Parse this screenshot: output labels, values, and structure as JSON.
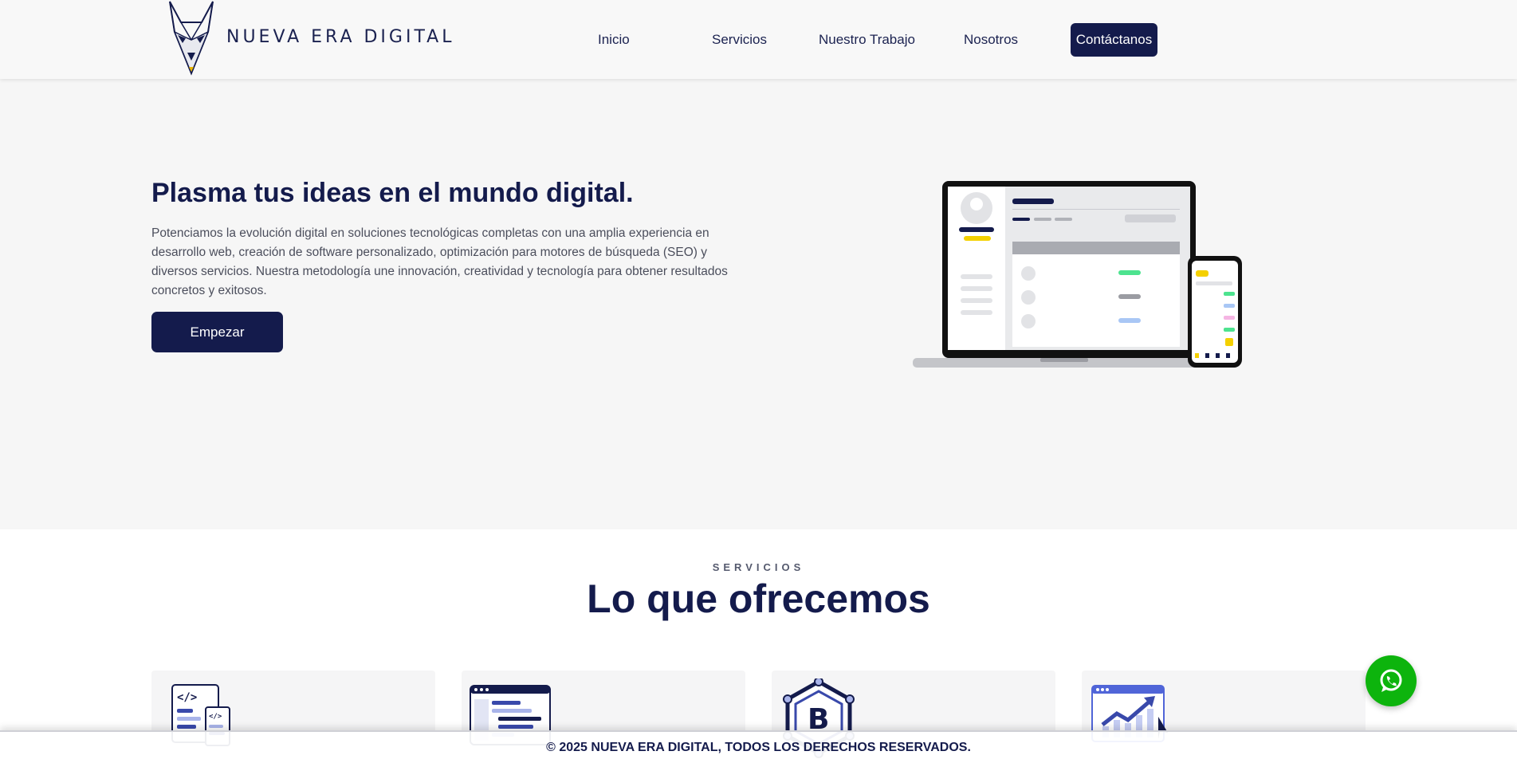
{
  "brand": {
    "name": "NUEVA ERA DIGITAL"
  },
  "nav": {
    "items": [
      "Inicio",
      "Servicios",
      "Nuestro Trabajo",
      "Nosotros"
    ],
    "cta": "Contáctanos"
  },
  "hero": {
    "title": "Plasma tus ideas en el mundo digital.",
    "text": "Potenciamos la evolución digital en soluciones tecnológicas completas con una amplia experiencia en desarrollo web, creación de software personalizado, optimización para motores de búsqueda (SEO) y diversos servicios. Nuestra metodología une innovación, creatividad y tecnología para obtener resultados concretos y exitosos.",
    "button": "Empezar"
  },
  "services": {
    "eyebrow": "SERVICIOS",
    "title": "Lo que ofrecemos",
    "cards": [
      {
        "icon": "code-devices-icon"
      },
      {
        "icon": "code-window-icon"
      },
      {
        "icon": "blockchain-icon"
      },
      {
        "icon": "growth-chart-icon"
      }
    ]
  },
  "footer": {
    "text": "© 2025 NUEVA ERA DIGITAL, TODOS LOS DERECHOS RESERVADOS."
  },
  "whatsapp": {
    "icon": "whatsapp-icon"
  },
  "colors": {
    "primary": "#141b4c",
    "hero_bg": "#f6f6f6",
    "whatsapp": "#0db40d"
  }
}
